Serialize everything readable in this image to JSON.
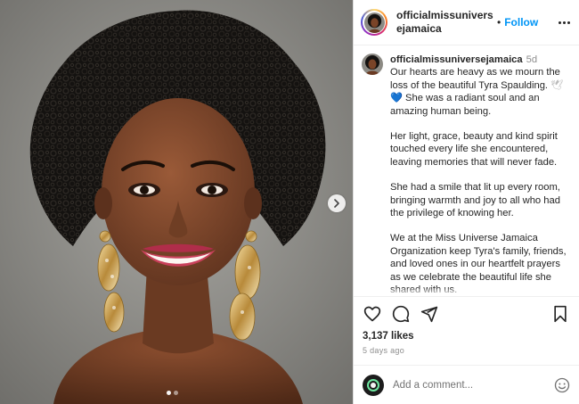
{
  "post": {
    "username": "officialmissuniversejamaica",
    "username_header": "officialmissuniversejamaica",
    "separator": "•",
    "follow_label": "Follow",
    "caption_time": "5d",
    "caption": {
      "p1_text": "Our hearts are heavy as we mourn the loss of the beautiful Tyra Spaulding.",
      "p1_emoji_dove": "🕊",
      "p1_emoji_heart": "💙",
      "p1_text2": "She was a radiant soul and an amazing human being.",
      "p2": "Her light, grace, beauty and kind spirit touched every life she encountered, leaving memories that will never fade.",
      "p3": "She had a smile that lit up every room, bringing warmth and joy to all who had the privilege of knowing her.",
      "p4": "We at the Miss Universe Jamaica Organization keep Tyra's family, friends, and loved ones in our heartfelt prayers as we celebrate the beautiful life she shared with us."
    },
    "likes": "3,137 likes",
    "posted_ago": "5 days ago",
    "comment_placeholder": "Add a comment...",
    "carousel": {
      "count": 2,
      "active_index": 0
    }
  },
  "icons": {
    "next": "chevron-right-icon",
    "like": "heart-outline-icon",
    "comment": "comment-bubble-icon",
    "share": "paper-plane-icon",
    "save": "bookmark-icon",
    "emoji": "smiley-face-icon",
    "more": "more-horizontal-icon"
  },
  "colors": {
    "follow": "#0095f6",
    "text": "#262626",
    "muted": "#8e8e8e"
  }
}
